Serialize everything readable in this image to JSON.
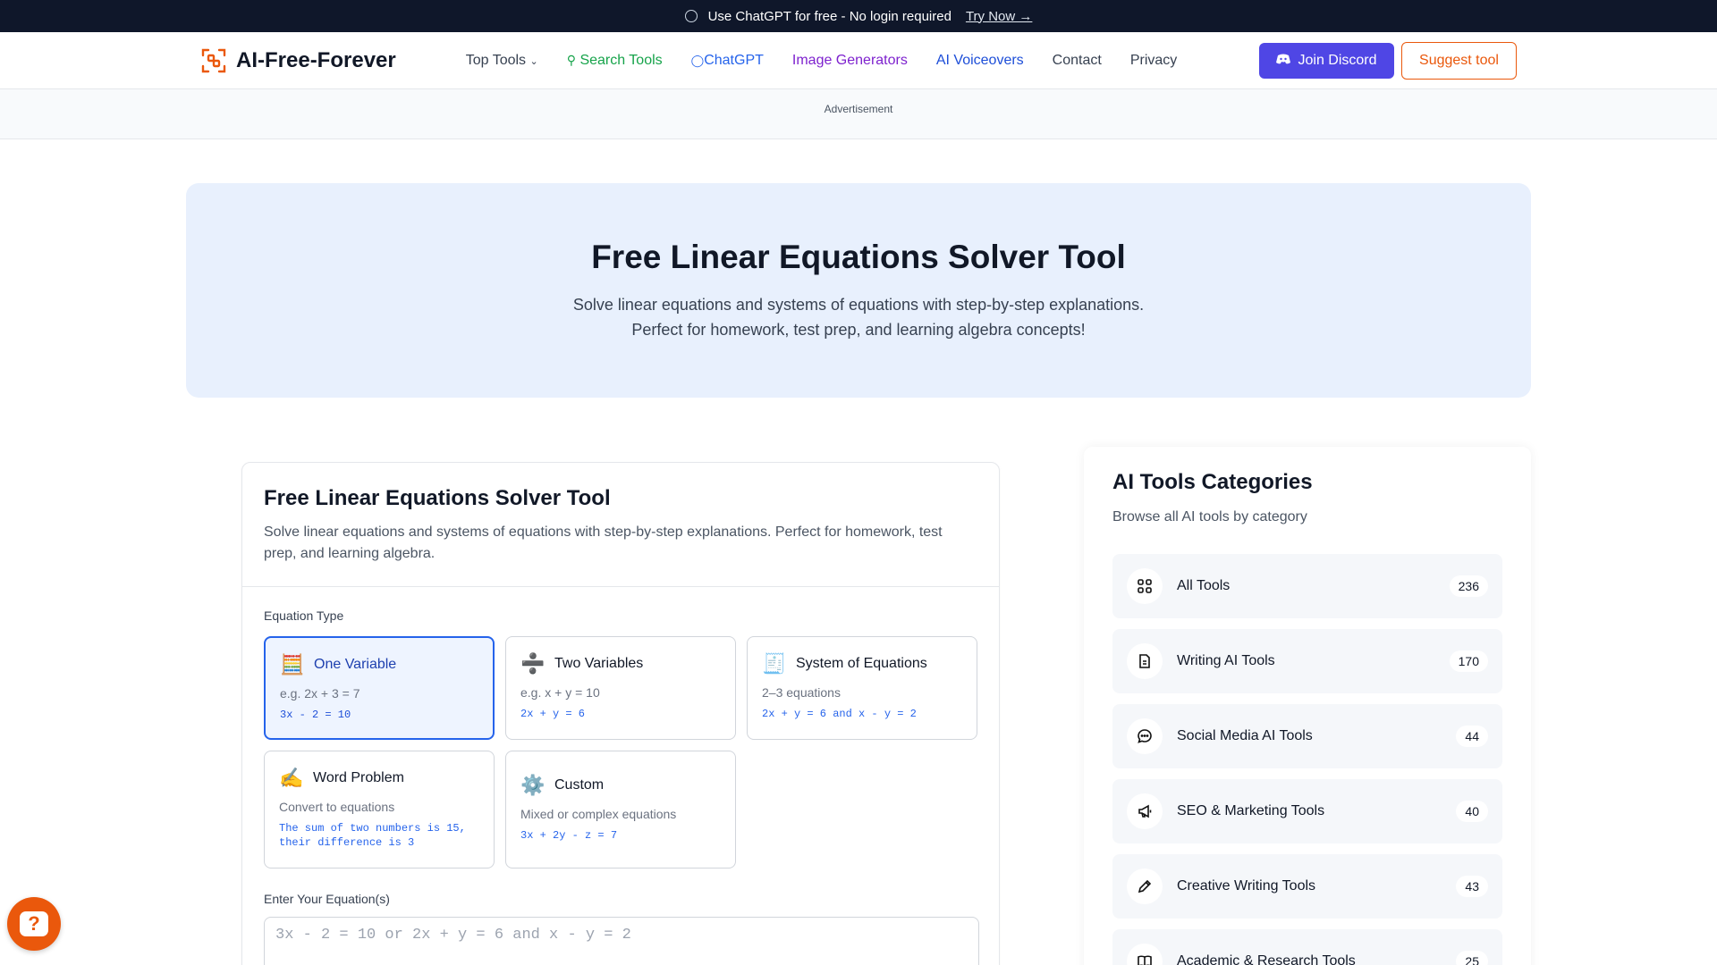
{
  "announcement": {
    "text": "Use ChatGPT for free - No login required",
    "link": "Try Now →"
  },
  "nav": {
    "brand": "AI-Free-Forever",
    "links": {
      "top_tools": "Top Tools",
      "search_tools": "Search Tools",
      "chatgpt": "ChatGPT",
      "image_generators": "Image Generators",
      "ai_voiceovers": "AI Voiceovers",
      "contact": "Contact",
      "privacy": "Privacy"
    },
    "join_discord": "Join Discord",
    "suggest_tool": "Suggest tool"
  },
  "ad_label": "Advertisement",
  "hero": {
    "title": "Free Linear Equations Solver Tool",
    "subtitle": "Solve linear equations and systems of equations with step-by-step explanations. Perfect for homework, test prep, and learning algebra concepts!"
  },
  "solver": {
    "title": "Free Linear Equations Solver Tool",
    "description": "Solve linear equations and systems of equations with step-by-step explanations. Perfect for homework, test prep, and learning algebra.",
    "equation_type_label": "Equation Type",
    "types": [
      {
        "icon": "🧮",
        "icon_name": "abacus-icon",
        "title": "One Variable",
        "example": "e.g. 2x + 3 = 7",
        "code": "3x - 2 = 10",
        "selected": true
      },
      {
        "icon": "➗",
        "icon_name": "divide-icon",
        "title": "Two Variables",
        "example": "e.g. x + y = 10",
        "code": "2x + y = 6",
        "selected": false
      },
      {
        "icon": "🧾",
        "icon_name": "receipt-icon",
        "title": "System of Equations",
        "example": "2–3 equations",
        "code": "2x + y = 6 and x - y = 2",
        "selected": false
      },
      {
        "icon": "✍️",
        "icon_name": "writing-hand-icon",
        "title": "Word Problem",
        "example": "Convert to equations",
        "code": "The sum of two numbers is 15, their difference is 3",
        "selected": false
      },
      {
        "icon": "⚙️",
        "icon_name": "gear-icon",
        "title": "Custom",
        "example": "Mixed or complex equations",
        "code": "3x + 2y - z = 7",
        "selected": false
      }
    ],
    "input_label": "Enter Your Equation(s)",
    "input_placeholder": "3x - 2 = 10 or 2x + y = 6 and x - y = 2",
    "input_value": ""
  },
  "categories": {
    "title": "AI Tools Categories",
    "subtitle": "Browse all AI tools by category",
    "items": [
      {
        "name": "All Tools",
        "count": "236",
        "icon": "grid-icon"
      },
      {
        "name": "Writing AI Tools",
        "count": "170",
        "icon": "document-icon"
      },
      {
        "name": "Social Media AI Tools",
        "count": "44",
        "icon": "chat-bubble-icon"
      },
      {
        "name": "SEO & Marketing Tools",
        "count": "40",
        "icon": "megaphone-icon"
      },
      {
        "name": "Creative Writing Tools",
        "count": "43",
        "icon": "pencil-icon"
      },
      {
        "name": "Academic & Research Tools",
        "count": "25",
        "icon": "book-icon"
      }
    ]
  },
  "colors": {
    "accent_orange": "#ea580c",
    "discord": "#4f46e5",
    "hero_bg": "#e8f0fd",
    "selected_border": "#2563eb"
  }
}
